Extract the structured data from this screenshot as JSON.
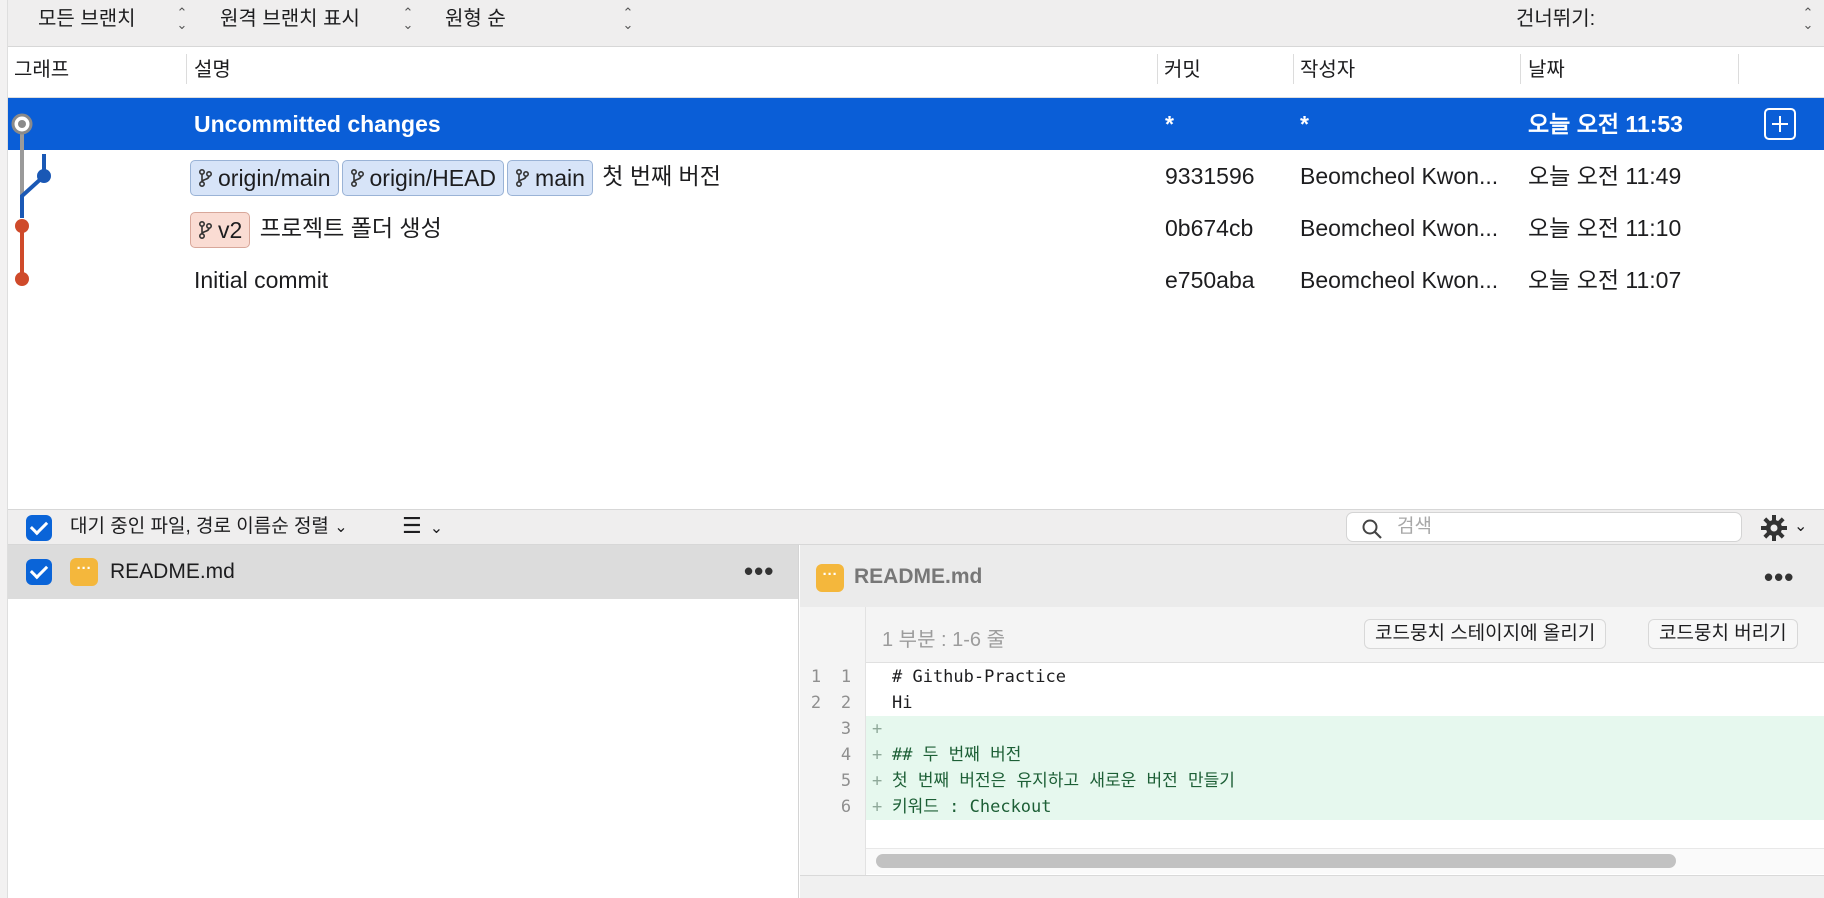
{
  "toolbar": {
    "branch_filter": "모든 브랜치",
    "remote_filter": "원격 브랜치 표시",
    "sort_order": "원형 순",
    "jump_to_label": "건너뛰기:"
  },
  "columns": {
    "graph": "그래프",
    "description": "설명",
    "commit": "커밋",
    "author": "작성자",
    "date": "날짜"
  },
  "commits": [
    {
      "description": "Uncommitted changes",
      "hash": "*",
      "author": "*",
      "date": "오늘 오전 11:53",
      "tags": []
    },
    {
      "description": "첫 번째 버전",
      "hash": "9331596",
      "author": "Beomcheol Kwon...",
      "date": "오늘 오전 11:49",
      "tags": [
        "origin/main",
        "origin/HEAD",
        "main"
      ]
    },
    {
      "description": "프로젝트 폴더 생성",
      "hash": "0b674cb",
      "author": "Beomcheol Kwon...",
      "date": "오늘 오전 11:10",
      "tags": [
        "v2"
      ]
    },
    {
      "description": "Initial commit",
      "hash": "e750aba",
      "author": "Beomcheol Kwon...",
      "date": "오늘 오전 11:07",
      "tags": []
    }
  ],
  "filebar": {
    "sort_label": "대기 중인 파일, 경로 이름순 정렬",
    "search_placeholder": "검색"
  },
  "files": [
    {
      "name": "README.md",
      "checked": true
    }
  ],
  "diff": {
    "file_name": "README.md",
    "hunk_label": "1 부분 : 1-6 줄",
    "stage_hunk_button": "코드뭉치 스테이지에 올리기",
    "discard_hunk_button": "코드뭉치 버리기",
    "lines": [
      {
        "old": "1",
        "new": "1",
        "type": "context",
        "text": "# Github-Practice"
      },
      {
        "old": "2",
        "new": "2",
        "type": "context",
        "text": "Hi"
      },
      {
        "old": "",
        "new": "3",
        "type": "add",
        "text": ""
      },
      {
        "old": "",
        "new": "4",
        "type": "add",
        "text": "## 두 번째 버전"
      },
      {
        "old": "",
        "new": "5",
        "type": "add",
        "text": "첫 번째 버전은 유지하고 새로운 버전 만들기"
      },
      {
        "old": "",
        "new": "6",
        "type": "add",
        "text": "키워드 : Checkout"
      }
    ]
  },
  "colors": {
    "selection": "#0a5ed7",
    "graph_main": "#1a58b5",
    "graph_v2": "#cf4a2a",
    "added_line_bg": "#e6f8ee"
  },
  "icons": {
    "add": "plus-square-icon",
    "search": "search-icon",
    "settings": "gear-icon",
    "more": "ellipsis-icon",
    "branch": "branch-icon",
    "modified_file": "modified-file-icon"
  }
}
